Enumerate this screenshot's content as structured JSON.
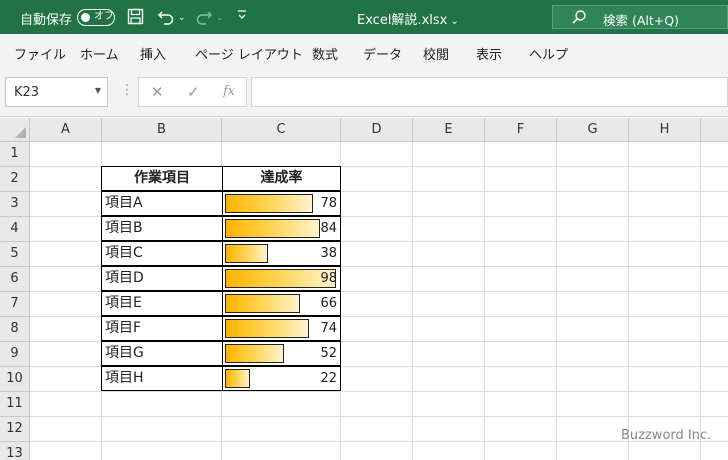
{
  "titlebar": {
    "autosave_label": "自動保存",
    "autosave_toggle": "オフ",
    "filename": "Excel解説.xlsx",
    "search_placeholder": "検索 (Alt+Q)"
  },
  "ribbon_tabs": [
    "ファイル",
    "ホーム",
    "挿入",
    "ページ レイアウト",
    "数式",
    "データ",
    "校閲",
    "表示",
    "ヘルプ"
  ],
  "formula_bar": {
    "name_box": "K23",
    "fx_label": "fx",
    "formula": ""
  },
  "columns": [
    "A",
    "B",
    "C",
    "D",
    "E",
    "F",
    "G",
    "H"
  ],
  "rows": [
    "1",
    "2",
    "3",
    "4",
    "5",
    "6",
    "7",
    "8",
    "9",
    "10",
    "11",
    "12",
    "13"
  ],
  "table": {
    "header_item": "作業項目",
    "header_rate": "達成率",
    "rows": [
      {
        "item": "項目A",
        "value": "78",
        "fraction": 0.78
      },
      {
        "item": "項目B",
        "value": "84",
        "fraction": 0.84
      },
      {
        "item": "項目C",
        "value": "38",
        "fraction": 0.38
      },
      {
        "item": "項目D",
        "value": "98",
        "fraction": 0.98
      },
      {
        "item": "項目E",
        "value": "66",
        "fraction": 0.66
      },
      {
        "item": "項目F",
        "value": "74",
        "fraction": 0.74
      },
      {
        "item": "項目G",
        "value": "52",
        "fraction": 0.52
      },
      {
        "item": "項目H",
        "value": "22",
        "fraction": 0.22
      }
    ]
  },
  "databar_color": "#ffb400",
  "watermark": "Buzzword Inc."
}
